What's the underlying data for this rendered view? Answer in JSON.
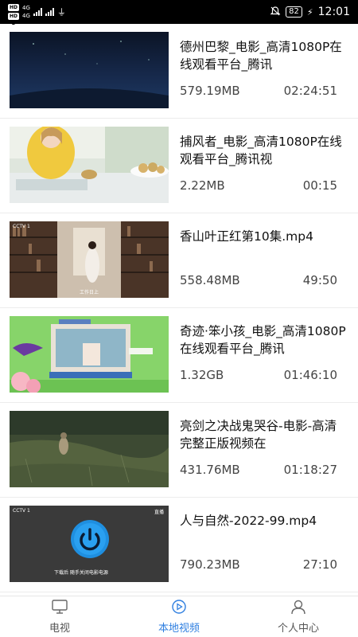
{
  "status_bar": {
    "sim1": "HD 1",
    "sim2": "HD 2",
    "net1": "4G",
    "net2": "4G",
    "battery": "82",
    "time": "12:01"
  },
  "videos": [
    {
      "title": "德州巴黎_电影_高清1080P在线观看平台_腾讯",
      "size": "579.19MB",
      "duration": "02:24:51"
    },
    {
      "title": "捕风者_电影_高清1080P在线观看平台_腾讯视",
      "size": "2.22MB",
      "duration": "00:15"
    },
    {
      "title": "香山叶正红第10集.mp4",
      "size": "558.48MB",
      "duration": "49:50"
    },
    {
      "title": "奇迹·笨小孩_电影_高清1080P在线观看平台_腾讯",
      "size": "1.32GB",
      "duration": "01:46:10"
    },
    {
      "title": "亮剑之决战鬼哭谷-电影-高清完整正版视频在",
      "size": "431.76MB",
      "duration": "01:18:27"
    },
    {
      "title": "人与自然-2022-99.mp4",
      "size": "790.23MB",
      "duration": "27:10"
    }
  ],
  "thumb_text": {
    "cctv": "CCTV 1",
    "live": "直播",
    "caption3": "工作日上",
    "caption6": "下载后  随手关闭电影电源"
  },
  "tabs": [
    {
      "label": "电视",
      "icon": "tv-icon"
    },
    {
      "label": "本地视频",
      "icon": "play-circle-icon"
    },
    {
      "label": "个人中心",
      "icon": "user-icon"
    }
  ],
  "colors": {
    "accent": "#2f7fe0"
  }
}
